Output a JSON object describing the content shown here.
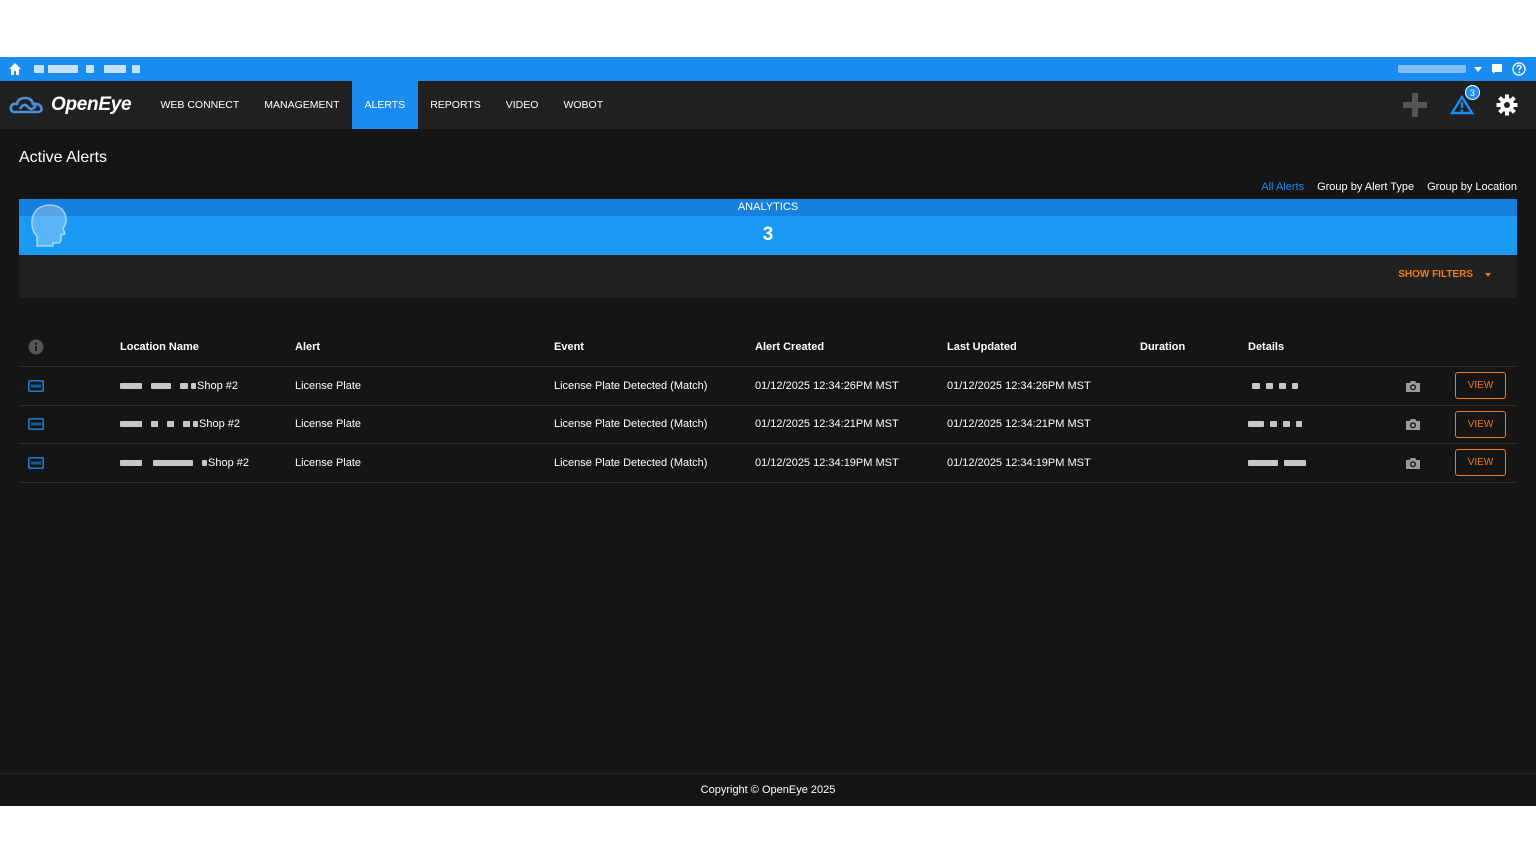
{
  "nav": {
    "brand": "OpenEye",
    "items": [
      {
        "label": "WEB CONNECT",
        "active": false
      },
      {
        "label": "MANAGEMENT",
        "active": false
      },
      {
        "label": "ALERTS",
        "active": true
      },
      {
        "label": "REPORTS",
        "active": false
      },
      {
        "label": "VIDEO",
        "active": false
      },
      {
        "label": "WOBOT",
        "active": false
      }
    ],
    "alert_badge": "3",
    "icons": [
      "plus-icon",
      "alert-bell-icon",
      "gear-icon"
    ]
  },
  "page": {
    "title": "Active Alerts",
    "group_links": [
      {
        "label": "All Alerts",
        "active": true
      },
      {
        "label": "Group by Alert Type",
        "active": false
      },
      {
        "label": "Group by Location",
        "active": false
      }
    ],
    "analytics": {
      "label": "ANALYTICS",
      "count": "3"
    },
    "show_filters": "SHOW FILTERS"
  },
  "table": {
    "headers": {
      "location": "Location Name",
      "alert": "Alert",
      "event": "Event",
      "created": "Alert Created",
      "updated": "Last Updated",
      "duration": "Duration",
      "details": "Details"
    },
    "rows": [
      {
        "location": "Shop #2",
        "alert": "License Plate",
        "event": "License Plate Detected (Match)",
        "created": "01/12/2025 12:34:26PM MST",
        "updated": "01/12/2025 12:34:26PM MST",
        "duration": "",
        "view": "VIEW"
      },
      {
        "location": "Shop #2",
        "alert": "License Plate",
        "event": "License Plate Detected (Match)",
        "created": "01/12/2025 12:34:21PM MST",
        "updated": "01/12/2025 12:34:21PM MST",
        "duration": "",
        "view": "VIEW"
      },
      {
        "location": "Shop #2",
        "alert": "License Plate",
        "event": "License Plate Detected (Match)",
        "created": "01/12/2025 12:34:19PM MST",
        "updated": "01/12/2025 12:34:19PM MST",
        "duration": "",
        "view": "VIEW"
      }
    ]
  },
  "footer": {
    "copyright": "Copyright © OpenEye 2025"
  },
  "colors": {
    "accent": "#1a8cf0",
    "action": "#f07b1a",
    "background": "#151515"
  }
}
